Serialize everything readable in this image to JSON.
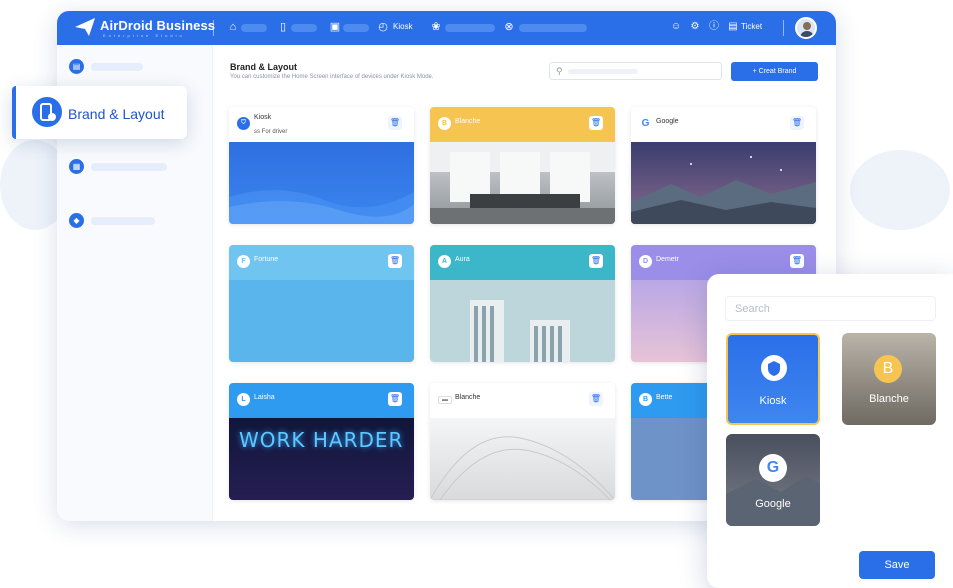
{
  "app": {
    "brand": "AirDroid Business",
    "brand_sub": "Enterprise Studio"
  },
  "topbar": {
    "kiosk_label": "Kiosk",
    "ticket_label": "Ticket"
  },
  "floating_nav": {
    "label": "Brand & Layout"
  },
  "main": {
    "title": "Brand & Layout",
    "subtitle": "You can customize the Home Screen interface of devices under Kiosk Mode.",
    "create_button": "+ Creat Brand"
  },
  "cards": [
    {
      "name": "Kiosk",
      "desc": "ss For driver",
      "icon": "shield-icon",
      "header_color": "#ffffff"
    },
    {
      "name": "Blanche",
      "desc": "",
      "icon": "B",
      "header_color": "#f5c451"
    },
    {
      "name": "Google",
      "desc": "",
      "icon": "G",
      "header_color": "#ffffff"
    },
    {
      "name": "Fortune",
      "desc": "",
      "icon": "F",
      "header_color": "#6fc4f0"
    },
    {
      "name": "Aura",
      "desc": "",
      "icon": "A",
      "header_color": "#3cb6c9"
    },
    {
      "name": "Demetr",
      "desc": "",
      "icon": "D",
      "header_color": "#9b8ee8"
    },
    {
      "name": "Laisha",
      "desc": "",
      "icon": "L",
      "header_color": "#2e9bf0"
    },
    {
      "name": "Blanche",
      "desc": "",
      "icon": "logo",
      "header_color": "#ffffff"
    },
    {
      "name": "Bette",
      "desc": "",
      "icon": "B",
      "header_color": "#2e9bf0"
    }
  ],
  "image_text": {
    "neon": "WORK HARDER"
  },
  "overlay": {
    "search_placeholder": "Search",
    "tiles": [
      {
        "label": "Kiosk"
      },
      {
        "label": "Blanche",
        "letter": "B"
      },
      {
        "label": "Google",
        "letter": "G"
      }
    ],
    "save_button": "Save"
  },
  "colors": {
    "accent": "#2a6fe8"
  }
}
